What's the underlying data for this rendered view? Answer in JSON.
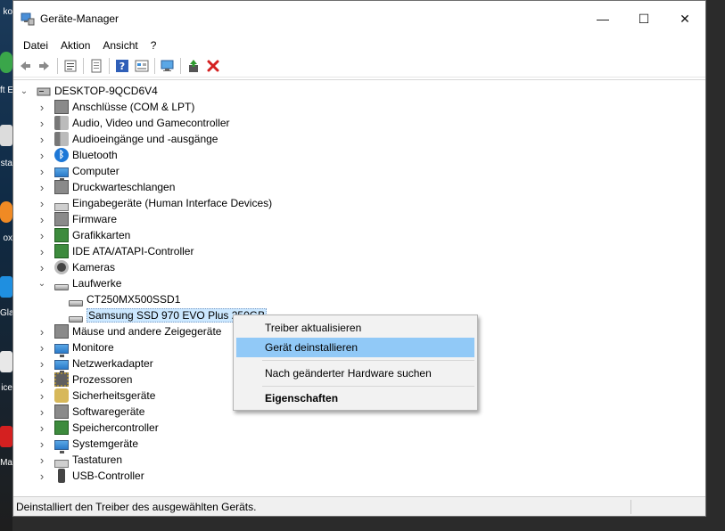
{
  "desktop": {
    "labels": [
      "ko",
      "ft E",
      "sta",
      "ox",
      "Gla",
      "ice",
      "Ma"
    ]
  },
  "window": {
    "title": "Geräte-Manager",
    "minimize_glyph": "—",
    "maximize_glyph": "☐",
    "close_glyph": "✕"
  },
  "menubar": {
    "items": [
      "Datei",
      "Aktion",
      "Ansicht",
      "?"
    ]
  },
  "toolbar": {
    "icons": [
      "back-arrow-icon",
      "forward-arrow-icon",
      "properties-list-icon",
      "page-icon",
      "help-icon",
      "view-icon",
      "scan-hardware-icon",
      "enable-driver-icon",
      "uninstall-x-icon"
    ],
    "accent_red": "#d42020",
    "accent_green": "#2e9b2e"
  },
  "tree": {
    "root": "DESKTOP-9QCD6V4",
    "categories": [
      {
        "label": "Anschlüsse (COM & LPT)",
        "icon": "port-icon"
      },
      {
        "label": "Audio, Video und Gamecontroller",
        "icon": "speaker-icon"
      },
      {
        "label": "Audioeingänge und -ausgänge",
        "icon": "speaker-icon"
      },
      {
        "label": "Bluetooth",
        "icon": "bluetooth-icon"
      },
      {
        "label": "Computer",
        "icon": "monitor-icon"
      },
      {
        "label": "Druckwarteschlangen",
        "icon": "printer-icon"
      },
      {
        "label": "Eingabegeräte (Human Interface Devices)",
        "icon": "hid-icon"
      },
      {
        "label": "Firmware",
        "icon": "firmware-icon"
      },
      {
        "label": "Grafikkarten",
        "icon": "display-adapter-icon"
      },
      {
        "label": "IDE ATA/ATAPI-Controller",
        "icon": "ide-controller-icon"
      },
      {
        "label": "Kameras",
        "icon": "camera-icon"
      },
      {
        "label": "Laufwerke",
        "icon": "drive-icon",
        "expanded": true
      },
      {
        "label": "Mäuse und andere Zeigegeräte",
        "icon": "mouse-icon"
      },
      {
        "label": "Monitore",
        "icon": "monitor-icon"
      },
      {
        "label": "Netzwerkadapter",
        "icon": "network-icon"
      },
      {
        "label": "Prozessoren",
        "icon": "cpu-icon"
      },
      {
        "label": "Sicherheitsgeräte",
        "icon": "security-key-icon"
      },
      {
        "label": "Softwaregeräte",
        "icon": "software-device-icon"
      },
      {
        "label": "Speichercontroller",
        "icon": "storage-controller-icon"
      },
      {
        "label": "Systemgeräte",
        "icon": "system-device-icon"
      },
      {
        "label": "Tastaturen",
        "icon": "keyboard-icon"
      },
      {
        "label": "USB-Controller",
        "icon": "usb-icon"
      }
    ],
    "drives": [
      "CT250MX500SSD1",
      "Samsung SSD 970 EVO Plus 250GB"
    ],
    "selection_color": "#cce8ff"
  },
  "context_menu": {
    "items": [
      "Treiber aktualisieren",
      "Gerät deinstallieren",
      "Nach geänderter Hardware suchen",
      "Eigenschaften"
    ],
    "highlight_color": "#91c9f7"
  },
  "statusbar": {
    "text": "Deinstalliert den Treiber des ausgewählten Geräts."
  }
}
